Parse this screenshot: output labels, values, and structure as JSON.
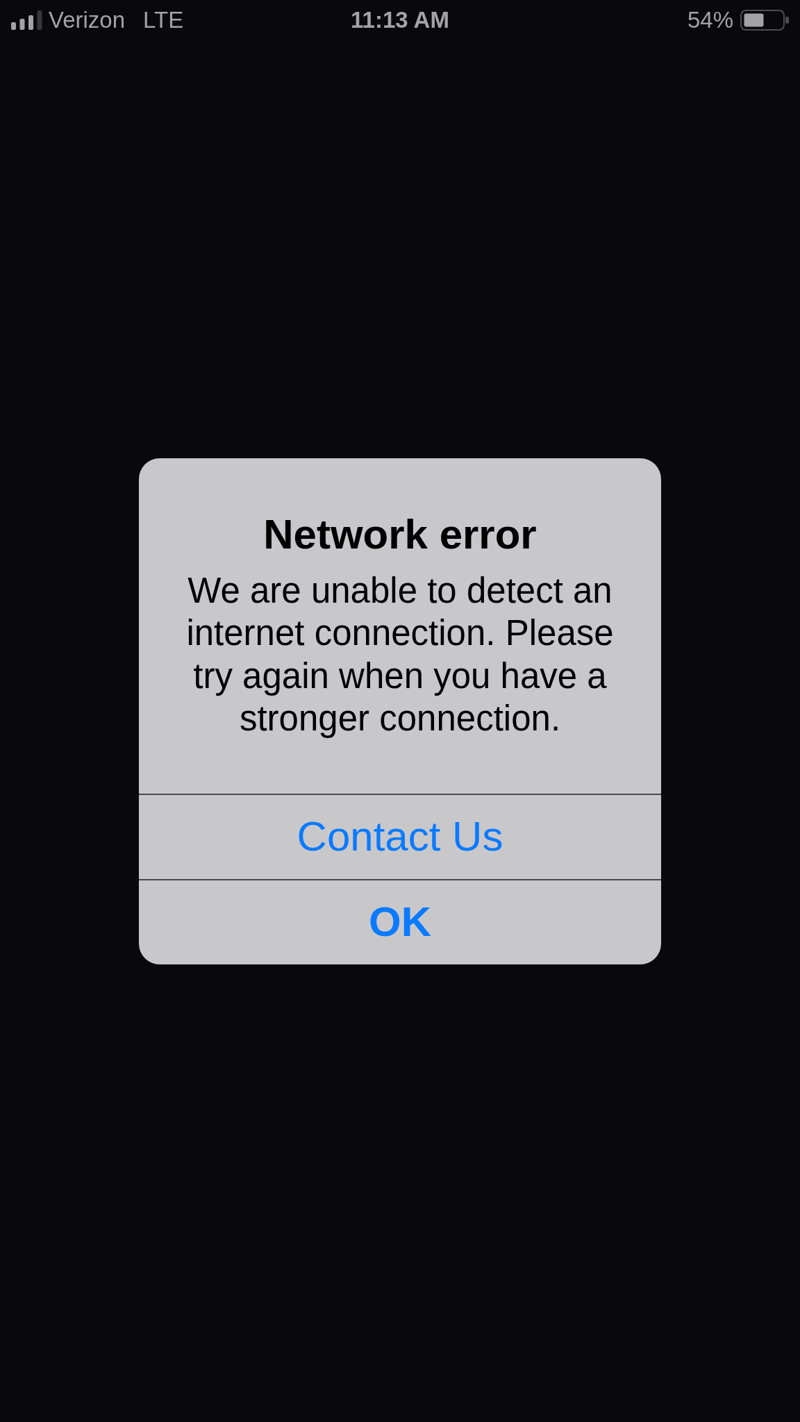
{
  "status_bar": {
    "carrier": "Verizon",
    "network": "LTE",
    "time": "11:13 AM",
    "battery_percent": "54%"
  },
  "alert": {
    "title": "Network error",
    "message": "We are unable to detect an internet connection. Please try again when you have a stronger connection.",
    "buttons": [
      {
        "label": "Contact Us",
        "kind": "default"
      },
      {
        "label": "OK",
        "kind": "preferred"
      }
    ]
  }
}
